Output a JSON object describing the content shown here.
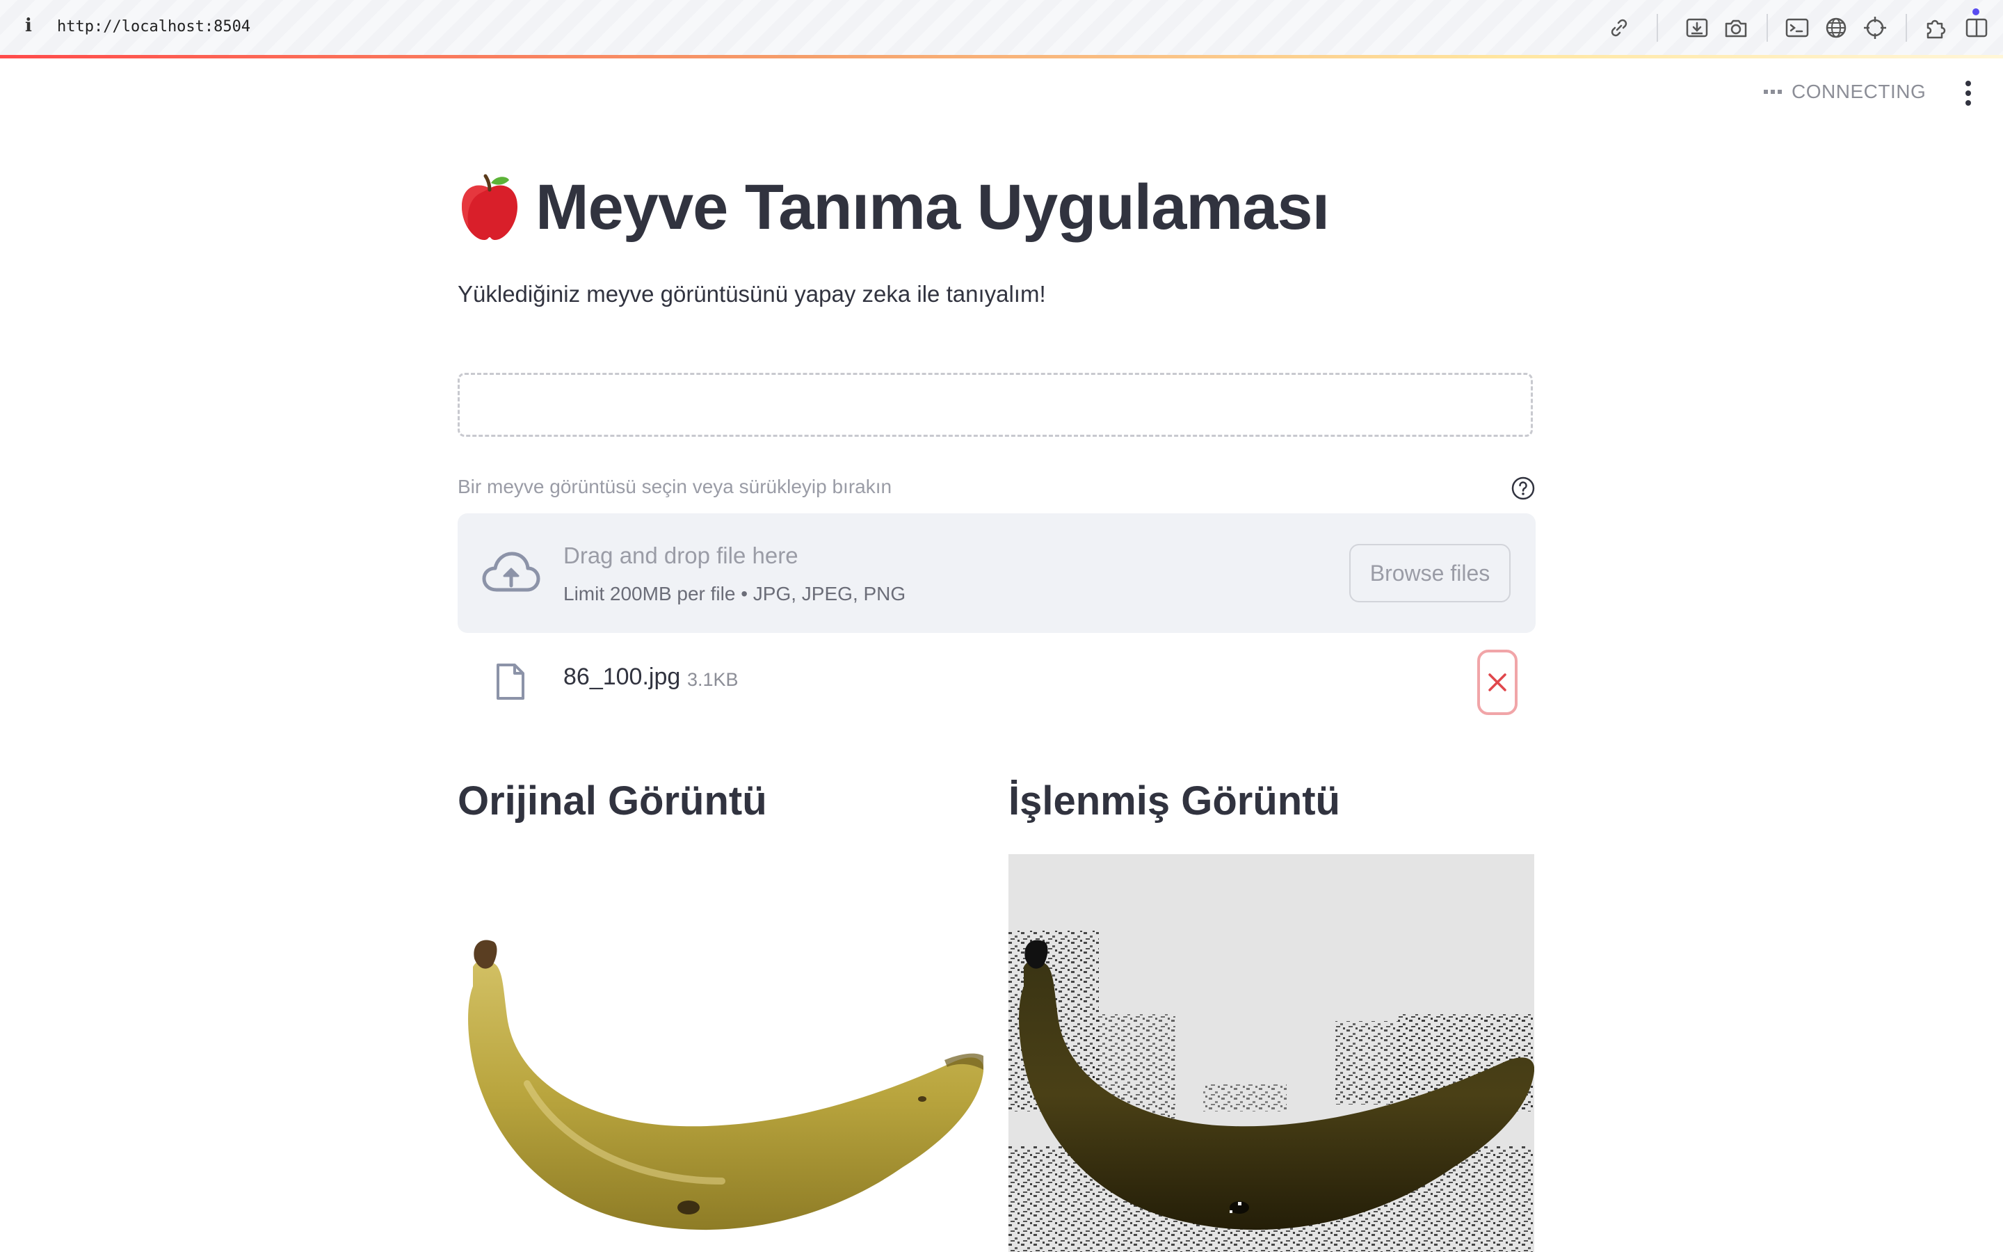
{
  "browser": {
    "url": "http://localhost:8504",
    "toolbar_icons": [
      "link-icon",
      "download-icon",
      "camera-icon",
      "terminal-icon",
      "globe-icon",
      "crosshair-icon",
      "extension-icon",
      "sidebar-icon"
    ]
  },
  "header": {
    "status": "CONNECTING",
    "menu_icon": "kebab-menu-icon"
  },
  "main": {
    "title_icon": "red-apple-emoji",
    "title": "Meyve Tanıma Uygulaması",
    "subtitle": "Yüklediğiniz meyve görüntüsünü yapay zeka ile tanıyalım!"
  },
  "uploader": {
    "label": "Bir meyve görüntüsü seçin veya sürükleyip bırakın",
    "drop_title": "Drag and drop file here",
    "limit": "Limit 200MB per file • JPG, JPEG, PNG",
    "browse_label": "Browse files",
    "file_name": "86_100.jpg",
    "file_size": "3.1KB"
  },
  "results": {
    "original_title": "Orijinal Görüntü",
    "processed_title": "İşlenmiş Görüntü"
  },
  "colors": {
    "accent": "#ff4b4b",
    "text": "#31333f",
    "muted": "#9a9ca6",
    "dropzone_bg": "#f0f2f6"
  }
}
